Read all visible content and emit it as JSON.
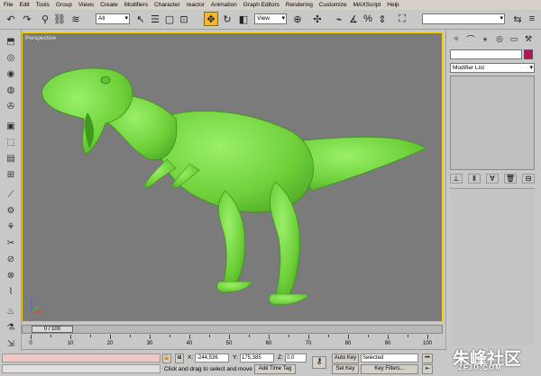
{
  "menu": [
    "File",
    "Edit",
    "Tools",
    "Group",
    "Views",
    "Create",
    "Modifiers",
    "Character",
    "reactor",
    "Animation",
    "Graph Editors",
    "Rendering",
    "Customize",
    "MAXScript",
    "Help"
  ],
  "toolbar": {
    "selection_filter": "All",
    "coord_system": "View"
  },
  "viewport": {
    "label": "Perspective",
    "model_color": "#7ddc47",
    "border_color": "#f0d000"
  },
  "command_panel": {
    "modifier_list": "Modifier List",
    "object_color": "#b0185a"
  },
  "timeline": {
    "slider_label": "0 / 100",
    "ticks": [
      "0",
      "10",
      "20",
      "30",
      "40",
      "50",
      "60",
      "70",
      "80",
      "90",
      "100"
    ]
  },
  "status": {
    "prompt": "Click and drag to select and move",
    "x_label": "X:",
    "x_value": "-244,536",
    "y_label": "Y:",
    "y_value": "175,385",
    "z_label": "Z:",
    "z_value": "0,0",
    "add_time_tag": "Add Time Tag",
    "auto_key": "Auto Key",
    "set_key": "Set Key",
    "selected": "Selected",
    "key_filters": "Key Filters..."
  },
  "watermark": {
    "text": "朱峰社区",
    "url": "ZF3D.COM"
  }
}
